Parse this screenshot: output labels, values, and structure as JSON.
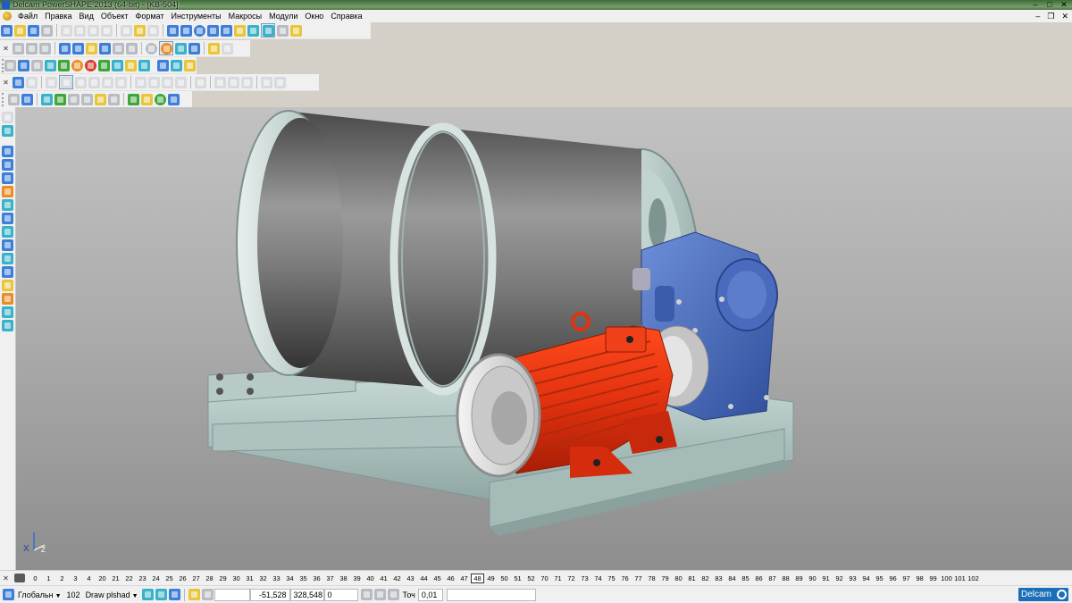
{
  "window": {
    "title": "Delcam PowerSHAPE 2013 (64-bit) - [KB-504]"
  },
  "menu": {
    "items": [
      "Файл",
      "Правка",
      "Вид",
      "Объект",
      "Формат",
      "Инструменты",
      "Макросы",
      "Модули",
      "Окно",
      "Справка"
    ]
  },
  "toolbars": {
    "row1_icons": [
      "new-icon",
      "open-icon",
      "save-icon",
      "print-icon",
      "cut-icon",
      "copy-icon",
      "paste-icon",
      "delete-icon",
      "undo-icon",
      "redo-icon",
      "select-icon",
      "line-icon",
      "arc-icon",
      "circle-icon",
      "curve-icon",
      "wireframe-icon",
      "surface-icon",
      "solid-icon",
      "shading-icon",
      "lightning-icon"
    ],
    "row2_icons": [
      "view-top-icon",
      "view-front-icon",
      "view-iso-icon",
      "zoom-in-icon",
      "zoom-out-icon",
      "zoom-fit-icon",
      "pan-icon",
      "rotate-icon",
      "shade-icon",
      "wire-icon",
      "render-icon",
      "info-icon"
    ],
    "row3_icons": [
      "layer-icon",
      "material-icon",
      "light-icon",
      "texture-icon",
      "transparency-icon",
      "color-icon",
      "analysis-icon",
      "section-icon",
      "measure-icon",
      "gauge-icon",
      "report-icon",
      "macro-icon"
    ],
    "row4_icons": [
      "solid-extrude-icon",
      "solid-revolve-icon",
      "solid-fillet-icon",
      "solid-chamfer-icon",
      "solid-shell-icon",
      "solid-boolean-icon",
      "solid-cut-icon",
      "solid-split-icon",
      "solid-mirror-icon",
      "solid-pattern-icon",
      "solid-feature-icon"
    ],
    "row5_icons": [
      "assembly-icon",
      "component-icon",
      "mate-icon",
      "drawing-icon",
      "electrode-icon",
      "mold-icon",
      "sheet-icon",
      "weld-icon",
      "parts-icon",
      "library-icon",
      "export-icon",
      "import-icon"
    ]
  },
  "viewport": {
    "axis_x_label": "X",
    "axis_z_label": "Z"
  },
  "levels": {
    "visible": [
      "0",
      "1",
      "2",
      "3",
      "4",
      "20",
      "21",
      "22",
      "23",
      "24",
      "25",
      "26",
      "27",
      "28",
      "29",
      "30",
      "31",
      "32",
      "33",
      "34",
      "35",
      "36",
      "37",
      "38",
      "39",
      "40",
      "41",
      "42",
      "43",
      "44",
      "45",
      "46",
      "47",
      "48",
      "49",
      "50",
      "51",
      "52",
      "70",
      "71",
      "72",
      "73",
      "74",
      "75",
      "76",
      "77",
      "78",
      "79",
      "80",
      "81",
      "82",
      "83",
      "84",
      "85",
      "86",
      "87",
      "88",
      "89",
      "90",
      "91",
      "92",
      "93",
      "94",
      "95",
      "96",
      "97",
      "98",
      "99",
      "100",
      "101",
      "102"
    ],
    "active": "48"
  },
  "status": {
    "workplane": "Глобальн",
    "level_number": "102",
    "level_name": "Draw plshad",
    "x": "-51,528",
    "y": "328,548",
    "z": "0",
    "tolerance_label": "Точ",
    "tolerance": "0,01",
    "logo": "Delcam"
  }
}
